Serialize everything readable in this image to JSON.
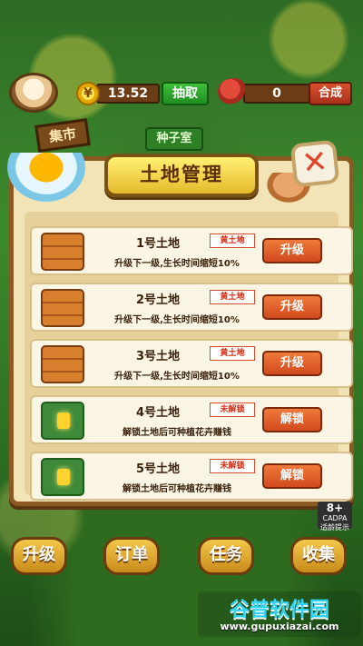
{
  "topbar": {
    "coin_symbol": "¥",
    "coin_value": "13.52",
    "withdraw_label": "抽取",
    "fruit_value": "0",
    "combine_label": "合成"
  },
  "background": {
    "market_sign": "集市",
    "seeds_sign": "种子室"
  },
  "panel": {
    "title": "土地管理",
    "close_symbol": "✕",
    "lands": [
      {
        "name": "1号土地",
        "badge": "黄土地",
        "desc": "升级下一级,生长时间缩短10%",
        "button": "升级",
        "state": "unlocked"
      },
      {
        "name": "2号土地",
        "badge": "黄土地",
        "desc": "升级下一级,生长时间缩短10%",
        "button": "升级",
        "state": "unlocked"
      },
      {
        "name": "3号土地",
        "badge": "黄土地",
        "desc": "升级下一级,生长时间缩短10%",
        "button": "升级",
        "state": "unlocked"
      },
      {
        "name": "4号土地",
        "badge": "未解锁",
        "desc": "解锁土地后可种植花卉赚钱",
        "button": "解锁",
        "state": "locked"
      },
      {
        "name": "5号土地",
        "badge": "未解锁",
        "desc": "解锁土地后可种植花卉赚钱",
        "button": "解锁",
        "state": "locked"
      }
    ]
  },
  "age_rating": {
    "top": "8+",
    "mid": "CADPA",
    "bottom": "适龄提示"
  },
  "bottom_nav": {
    "upgrade": "升级",
    "orders": "订单",
    "tasks": "任务",
    "collect": "收集"
  },
  "watermark": {
    "title": "谷普软件园",
    "url": "www.gupuxiazai.com"
  },
  "colors": {
    "panel_bg": "#f3e4b8",
    "button_orange": "#e2612a",
    "accent_gold": "#e5b92a"
  }
}
